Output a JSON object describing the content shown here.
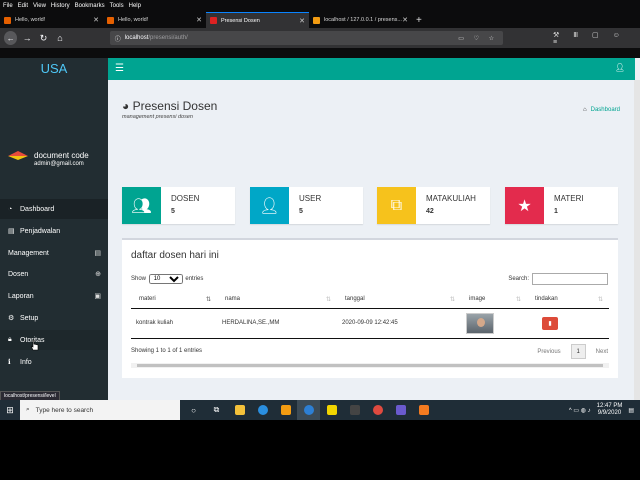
{
  "browser": {
    "menu": [
      "File",
      "Edit",
      "View",
      "History",
      "Bookmarks",
      "Tools",
      "Help"
    ],
    "tabs": [
      {
        "title": "Hello, world!",
        "active": false
      },
      {
        "title": "Hello, world!",
        "active": false
      },
      {
        "title": "Presensi Dosen",
        "active": true
      },
      {
        "title": "localhost / 127.0.0.1 / presens...",
        "active": false
      }
    ],
    "url_host": "localhost",
    "url_path": "/presensi/auth/",
    "status_url": "localhost/presensi/level"
  },
  "sidebar": {
    "logo": "USA",
    "user_name": "document code",
    "user_email": "admin@gmail.com",
    "items": [
      {
        "label": "Dashboard",
        "icon": "dashboard-icon"
      },
      {
        "label": "Penjadwalan",
        "icon": "calendar-icon"
      },
      {
        "label": "Management",
        "icon": "list-icon"
      },
      {
        "label": "Dosen",
        "icon": "plus-circle-icon"
      },
      {
        "label": "Laporan",
        "icon": "report-icon"
      },
      {
        "label": "Setup",
        "icon": "gear-icon"
      },
      {
        "label": "Otoritas",
        "icon": "lock-icon"
      },
      {
        "label": "Info",
        "icon": "info-icon"
      }
    ]
  },
  "header": {
    "title": "Presensi Dosen",
    "subtitle": "management presensi dosen",
    "breadcrumb": "Dashboard"
  },
  "infoboxes": [
    {
      "title": "DOSEN",
      "value": "5",
      "color": "#00a491",
      "icon": "users-icon"
    },
    {
      "title": "USER",
      "value": "5",
      "color": "#00a7c7",
      "icon": "user-icon"
    },
    {
      "title": "MATAKULIAH",
      "value": "42",
      "color": "#f6c21c",
      "icon": "copy-icon"
    },
    {
      "title": "MATERI",
      "value": "1",
      "color": "#e32b4d",
      "icon": "star-icon"
    }
  ],
  "table": {
    "title": "daftar dosen hari ini",
    "show_label": "Show",
    "entries_label": "entries",
    "page_size": "10",
    "search_label": "Search:",
    "columns": [
      "materi",
      "nama",
      "tanggal",
      "image",
      "tindakan"
    ],
    "rows": [
      {
        "materi": "kontrak kuliah",
        "nama": "HERDALINA,SE.,MM",
        "tanggal": "2020-09-09 12:42:45"
      }
    ],
    "info": "Showing 1 to 1 of 1 entries",
    "prev": "Previous",
    "page": "1",
    "next": "Next"
  },
  "taskbar": {
    "search_placeholder": "Type here to search",
    "time": "12:47 PM",
    "date": "9/9/2020"
  }
}
